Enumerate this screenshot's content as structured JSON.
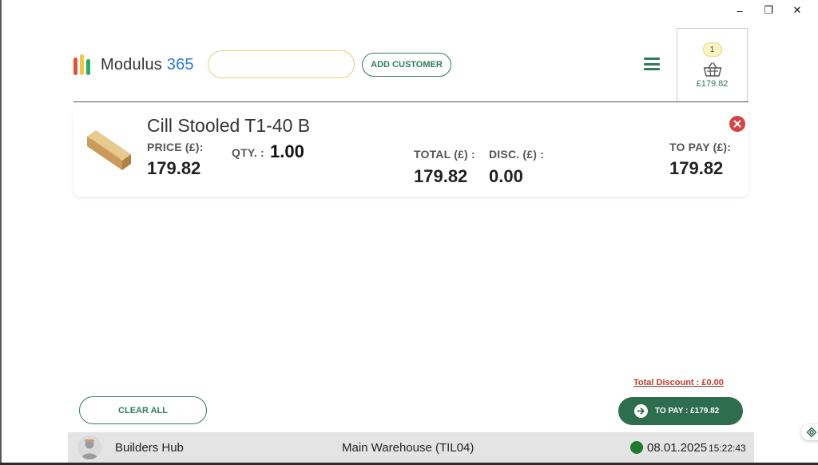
{
  "window": {
    "minimize_glyph": "–",
    "restore_glyph": "❐",
    "close_glyph": "✕"
  },
  "brand": {
    "name": "Modulus",
    "number": "365",
    "colors": {
      "bar1": "#e74c3c",
      "bar2": "#f4c542",
      "bar3": "#27ae60",
      "accent": "#2e7d5b"
    }
  },
  "search": {
    "value": "",
    "placeholder": "",
    "search_icon": "search-icon",
    "scan_icon": "barcode-icon"
  },
  "header": {
    "add_customer_label": "ADD CUSTOMER",
    "menu_icon": "hamburger-icon"
  },
  "basket": {
    "count": "1",
    "total": "£179.82",
    "icon": "basket-icon"
  },
  "cart": {
    "items": [
      {
        "name": "Cill Stooled T1-40 B",
        "price_label": "PRICE (£):",
        "price": "179.82",
        "qty_label": "QTY. :",
        "qty": "1.00",
        "total_label": "TOTAL (£) :",
        "total": "179.82",
        "disc_label": "DISC. (£) :",
        "disc": "0.00",
        "to_pay_label": "TO PAY (£):",
        "to_pay": "179.82"
      }
    ]
  },
  "footer": {
    "total_discount": "Total Discount : £0.00",
    "clear_all_label": "CLEAR ALL",
    "to_pay_label": "TO PAY : £179.82"
  },
  "status": {
    "store": "Builders Hub",
    "warehouse": "Main Warehouse (TIL04)",
    "date": "08.01.2025",
    "time": "15:22:43",
    "online_color": "#1e7a2e"
  }
}
